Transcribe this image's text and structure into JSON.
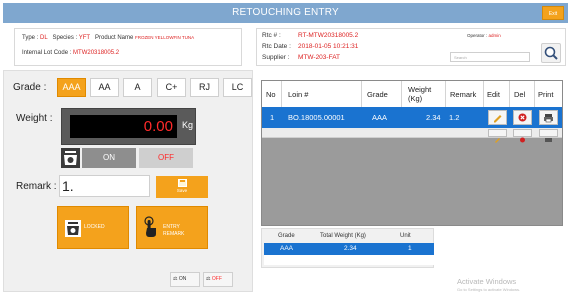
{
  "header": {
    "title": "RETOUCHING ENTRY",
    "exit_label": "Exit"
  },
  "info": {
    "type_label": "Type :",
    "type_value": "DL",
    "species_label": "Species :",
    "species_value": "YFT",
    "product_label": "Product Name",
    "product_value": "FROZEN YELLOWFIN TUNA",
    "lot_label": "Internal Lot Code :",
    "lot_value": "MTW20318005.2"
  },
  "rtc": {
    "rtc_label": "Rtc # :",
    "rtc_value": "RT-MTW20318005.2",
    "date_label": "Rtc Date :",
    "date_value": "2018-01-05 10:21:31",
    "supplier_label": "Supplier :",
    "supplier_value": "MTW-203-FAT",
    "operator_label": "Operator :",
    "operator_value": "admin",
    "search_placeholder": "Search"
  },
  "grade": {
    "label": "Grade :",
    "options": [
      "AAA",
      "AA",
      "A",
      "C+",
      "RJ",
      "LC"
    ],
    "selected": "AAA"
  },
  "weight": {
    "label": "Weight :",
    "value": "0.00",
    "unit": "Kg"
  },
  "scale": {
    "on_label": "ON",
    "off_label": "OFF"
  },
  "remark": {
    "label": "Remark :",
    "value": "1.",
    "save_label": "Save"
  },
  "actions": {
    "locked_label": "LOCKED",
    "entry_remark_label_1": "ENTRY",
    "entry_remark_label_2": "REMARK"
  },
  "bottom_toggles": {
    "on_label": "ON",
    "off_label": "OFF"
  },
  "grid": {
    "columns": [
      "No",
      "Loin #",
      "Grade",
      "Weight (Kg)",
      "Remark",
      "Edit",
      "Del",
      "Print"
    ],
    "rows": [
      {
        "no": "1",
        "loin": "BO.18005.00001",
        "grade": "AAA",
        "weight": "2.34",
        "remark": "1.2"
      }
    ]
  },
  "summary": {
    "columns": [
      "Grade",
      "Total Weight (Kg)",
      "Unit"
    ],
    "rows": [
      {
        "grade": "AAA",
        "total": "2.34",
        "unit": "1"
      }
    ]
  },
  "watermark": {
    "line1": "Activate Windows",
    "line2": "Go to Settings to activate Windows."
  },
  "colors": {
    "accent_orange": "#f4a21c",
    "title_blue": "#7fa7cf",
    "row_blue": "#1a73d0",
    "display_red": "#ff2a2a"
  }
}
